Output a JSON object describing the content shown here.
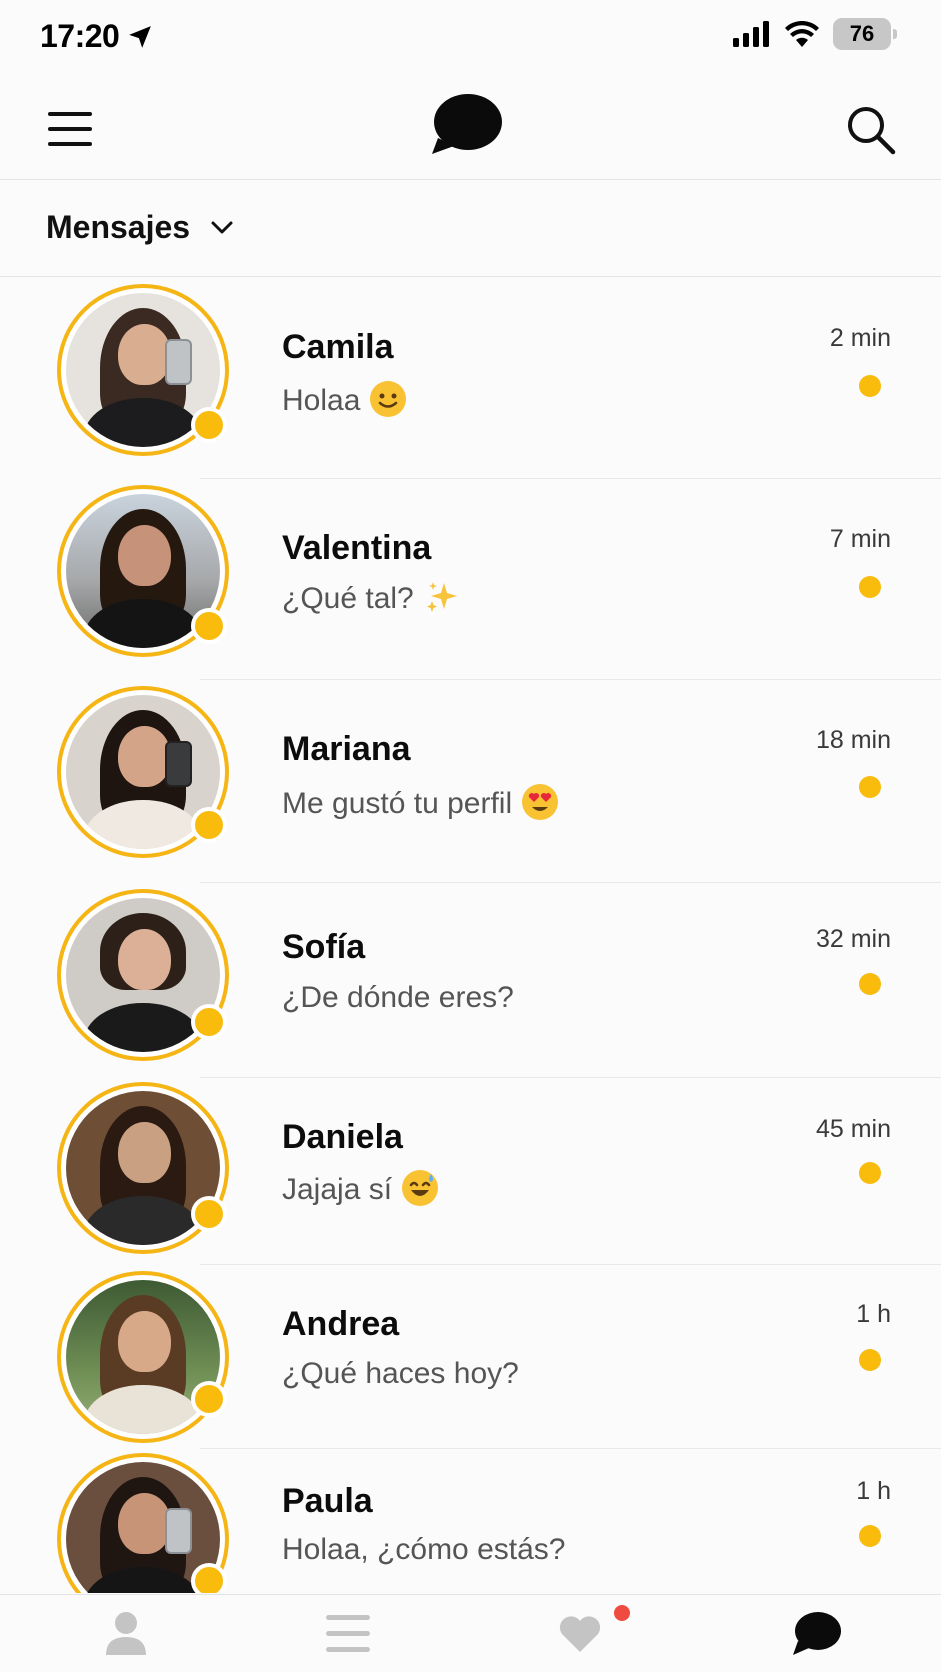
{
  "status_bar": {
    "time": "17:20",
    "battery": "76"
  },
  "header": {
    "filter_label": "Mensajes"
  },
  "colors": {
    "accent": "#f9bb0c",
    "ring": "#f5b515",
    "notification": "#ef4b40"
  },
  "conversations": [
    {
      "name": "Camila",
      "preview": "Holaa",
      "emoji": "smiling-face",
      "time": "2 min"
    },
    {
      "name": "Valentina",
      "preview": "¿Qué tal?",
      "emoji": "sparkles",
      "time": "7 min"
    },
    {
      "name": "Mariana",
      "preview": "Me gustó tu perfil",
      "emoji": "heart-eyes",
      "time": "18 min"
    },
    {
      "name": "Sofía",
      "preview": "¿De dónde eres?",
      "emoji": "",
      "time": "32 min"
    },
    {
      "name": "Daniela",
      "preview": "Jajaja sí",
      "emoji": "sweat-smile",
      "time": "45 min"
    },
    {
      "name": "Andrea",
      "preview": "¿Qué haces hoy?",
      "emoji": "",
      "time": "1 h"
    },
    {
      "name": "Paula",
      "preview": "Holaa, ¿cómo estás?",
      "emoji": "",
      "time": "1 h"
    }
  ],
  "tabs": [
    {
      "icon": "profile-icon"
    },
    {
      "icon": "list-icon"
    },
    {
      "icon": "heart-icon"
    },
    {
      "icon": "chat-icon"
    }
  ]
}
